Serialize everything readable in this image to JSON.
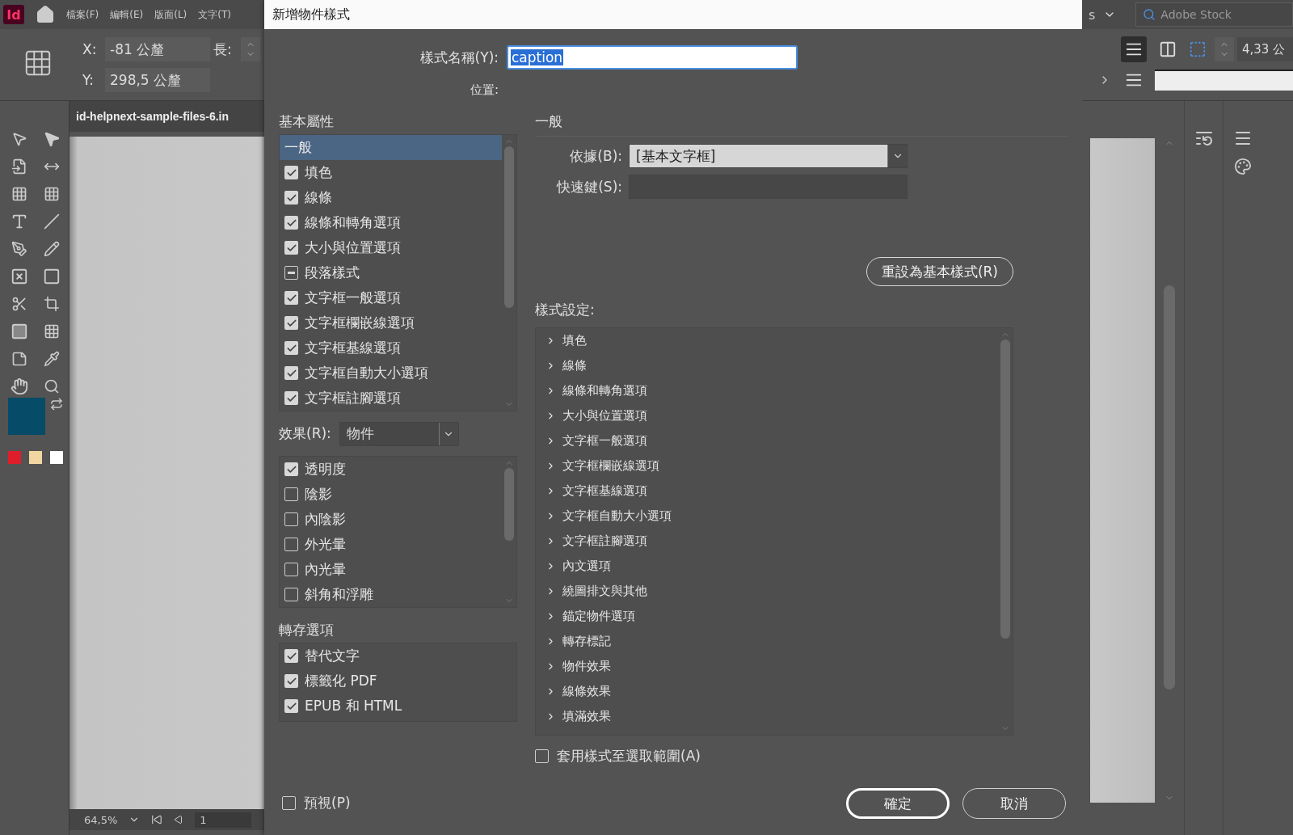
{
  "app": {
    "logo": "Id",
    "menu": [
      "檔案(F)",
      "編輯(E)",
      "版面(L)",
      "文字(T)"
    ],
    "control": {
      "x_label": "X:",
      "x_value": "-81 公釐",
      "y_label": "Y:",
      "y_value": "298,5 公釐",
      "length_label": "長:"
    },
    "document_tab": "id-helpnext-sample-files-6.in",
    "zoom": "64,5%",
    "page": "1",
    "right": {
      "workspace": "s",
      "stock_search": "Adobe Stock",
      "stroke_value": "4,33 公"
    }
  },
  "dialog": {
    "title": "新增物件樣式",
    "name_label": "樣式名稱(Y):",
    "name_value": "caption",
    "location_label": "位置:",
    "basic_heading": "基本屬性",
    "basic_items": [
      {
        "label": "一般",
        "kind": "plain",
        "selected": true
      },
      {
        "label": "填色",
        "kind": "check",
        "selected": false,
        "checked": true,
        "mixed": false
      },
      {
        "label": "線條",
        "kind": "check",
        "selected": false,
        "checked": true,
        "mixed": false
      },
      {
        "label": "線條和轉角選項",
        "kind": "check",
        "selected": false,
        "checked": true,
        "mixed": false
      },
      {
        "label": "大小與位置選項",
        "kind": "check",
        "selected": false,
        "checked": true,
        "mixed": false
      },
      {
        "label": "段落樣式",
        "kind": "check",
        "selected": false,
        "checked": false,
        "mixed": true
      },
      {
        "label": "文字框一般選項",
        "kind": "check",
        "selected": false,
        "checked": true,
        "mixed": false
      },
      {
        "label": "文字框欄嵌線選項",
        "kind": "check",
        "selected": false,
        "checked": true,
        "mixed": false
      },
      {
        "label": "文字框基線選項",
        "kind": "check",
        "selected": false,
        "checked": true,
        "mixed": false
      },
      {
        "label": "文字框自動大小選項",
        "kind": "check",
        "selected": false,
        "checked": true,
        "mixed": false
      },
      {
        "label": "文字框註腳選項",
        "kind": "check",
        "selected": false,
        "checked": true,
        "mixed": false
      }
    ],
    "effects_label": "效果(R):",
    "effects_value": "物件",
    "effect_items": [
      {
        "label": "透明度",
        "checked": true
      },
      {
        "label": "陰影",
        "checked": false
      },
      {
        "label": "內陰影",
        "checked": false
      },
      {
        "label": "外光暈",
        "checked": false
      },
      {
        "label": "內光暈",
        "checked": false
      },
      {
        "label": "斜角和浮雕",
        "checked": false
      }
    ],
    "export_heading": "轉存選項",
    "export_items": [
      {
        "label": "替代文字",
        "checked": true
      },
      {
        "label": "標籤化 PDF",
        "checked": true
      },
      {
        "label": "EPUB 和 HTML",
        "checked": true
      }
    ],
    "preview": {
      "label": "預視(P)",
      "checked": false
    },
    "section_heading": "一般",
    "based_on_label": "依據(B):",
    "based_on_value": "[基本文字框]",
    "shortcut_label": "快速鍵(S):",
    "reset_button": "重設為基本樣式(R)",
    "settings_label": "樣式設定:",
    "settings_tree": [
      {
        "label": "填色",
        "expanded": false
      },
      {
        "label": "線條",
        "expanded": false
      },
      {
        "label": "線條和轉角選項",
        "expanded": false
      },
      {
        "label": "大小與位置選項",
        "expanded": false
      },
      {
        "label": "文字框一般選項",
        "expanded": false
      },
      {
        "label": "文字框欄嵌線選項",
        "expanded": false
      },
      {
        "label": "文字框基線選項",
        "expanded": false
      },
      {
        "label": "文字框自動大小選項",
        "expanded": false
      },
      {
        "label": "文字框註腳選項",
        "expanded": false
      },
      {
        "label": "內文選項",
        "expanded": false
      },
      {
        "label": "繞圖排文與其他",
        "expanded": false
      },
      {
        "label": "錨定物件選項",
        "expanded": false
      },
      {
        "label": "轉存標記",
        "expanded": false
      },
      {
        "label": "物件效果",
        "expanded": false
      },
      {
        "label": "線條效果",
        "expanded": false
      },
      {
        "label": "填滿效果",
        "expanded": false
      }
    ],
    "apply": {
      "label": "套用樣式至選取範圍(A)",
      "checked": false
    },
    "ok_button": "確定",
    "cancel_button": "取消"
  }
}
